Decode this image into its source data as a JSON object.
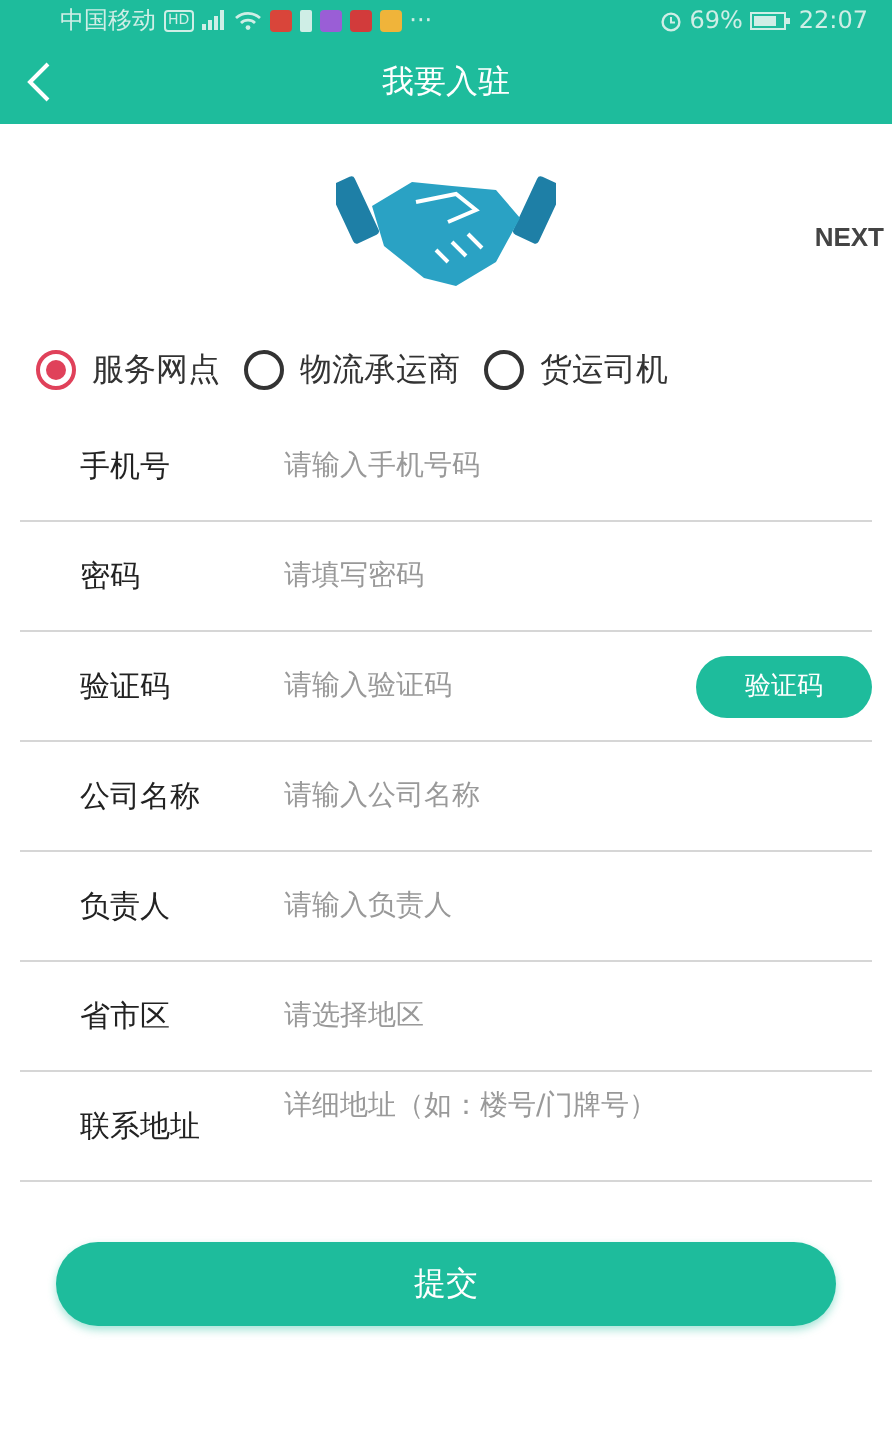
{
  "status_bar": {
    "carrier": "中国移动",
    "network": "HD",
    "more": "···",
    "battery": "69%",
    "time": "22:07"
  },
  "nav": {
    "title": "我要入驻"
  },
  "banner": {
    "next": "NEXT"
  },
  "roles": [
    {
      "label": "服务网点",
      "selected": true
    },
    {
      "label": "物流承运商",
      "selected": false
    },
    {
      "label": "货运司机",
      "selected": false
    }
  ],
  "fields": [
    {
      "kind": "text",
      "label": "手机号",
      "placeholder": "请输入手机号码"
    },
    {
      "kind": "text",
      "label": "密码",
      "placeholder": "请填写密码"
    },
    {
      "kind": "code",
      "label": "验证码",
      "placeholder": "请输入验证码",
      "button": "验证码"
    },
    {
      "kind": "text",
      "label": "公司名称",
      "placeholder": "请输入公司名称"
    },
    {
      "kind": "text",
      "label": "负责人",
      "placeholder": "请输入负责人"
    },
    {
      "kind": "text",
      "label": "省市区",
      "placeholder": "请选择地区"
    },
    {
      "kind": "multiline",
      "label": "联系地址",
      "placeholder": "详细地址（如：楼号/门牌号）"
    }
  ],
  "submit": "提交"
}
